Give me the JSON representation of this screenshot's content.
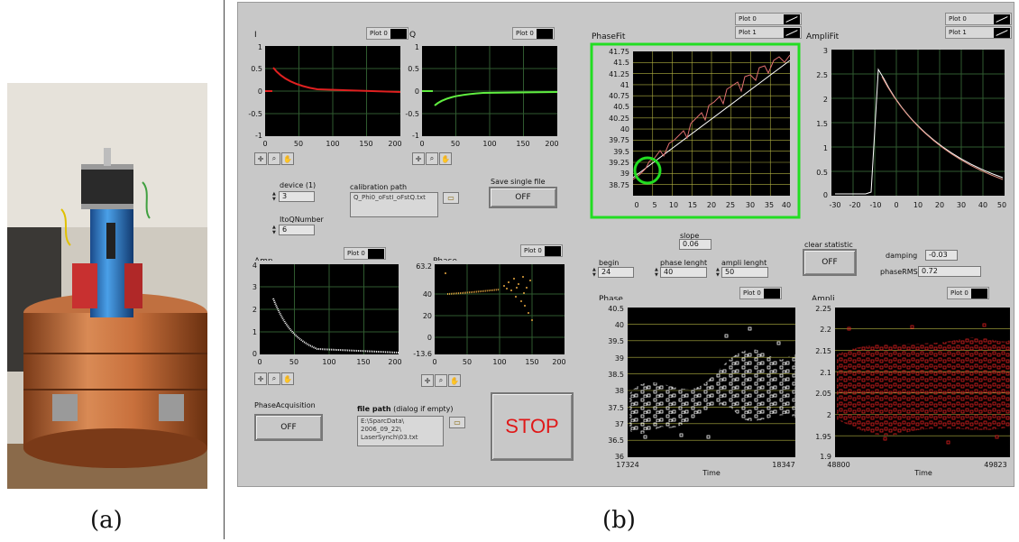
{
  "captions": {
    "a": "(a)",
    "b": "(b)"
  },
  "panel": {
    "plots": {
      "i": {
        "title": "I",
        "legend": "Plot 0",
        "y_ticks": [
          "1",
          "0.5",
          "0",
          "-0.5",
          "-1"
        ],
        "x_ticks": [
          "0",
          "50",
          "100",
          "150",
          "200"
        ]
      },
      "q": {
        "title": "Q",
        "legend": "Plot 0",
        "y_ticks": [
          "1",
          "0.5",
          "0",
          "-0.5",
          "-1"
        ],
        "x_ticks": [
          "0",
          "50",
          "100",
          "150",
          "200"
        ]
      },
      "phasefit": {
        "title": "PhaseFit",
        "legends": [
          "Plot 0",
          "Plot 1"
        ],
        "y_ticks": [
          "41.75",
          "41.5",
          "41.25",
          "41",
          "40.75",
          "40.5",
          "40.25",
          "40",
          "39.75",
          "39.5",
          "39.25",
          "39",
          "38.75"
        ],
        "x_ticks": [
          "0",
          "5",
          "10",
          "15",
          "20",
          "25",
          "30",
          "35",
          "40"
        ]
      },
      "amplifit": {
        "title": "AmpliFit",
        "legends": [
          "Plot 0",
          "Plot 1"
        ],
        "y_ticks": [
          "3",
          "2.5",
          "2",
          "1.5",
          "1",
          "0.5",
          "0"
        ],
        "x_ticks": [
          "-30",
          "-20",
          "-10",
          "0",
          "10",
          "20",
          "30",
          "40",
          "50"
        ]
      },
      "amp": {
        "title": "Amp",
        "legend": "Plot 0",
        "y_ticks": [
          "4",
          "3",
          "2",
          "1",
          "0"
        ],
        "x_ticks": [
          "0",
          "50",
          "100",
          "150",
          "200"
        ]
      },
      "phase_small": {
        "title": "Phase",
        "legend": "Plot 0",
        "y_ticks": [
          "63.2",
          "40",
          "20",
          "0",
          "-13.6"
        ],
        "x_ticks": [
          "0",
          "50",
          "100",
          "150",
          "200"
        ]
      },
      "phase_big": {
        "title": "Phase",
        "legend": "Plot 0",
        "y_ticks": [
          "40.5",
          "40",
          "39.5",
          "39",
          "38.5",
          "38",
          "37.5",
          "37",
          "36.5",
          "36"
        ],
        "x_ticks": [
          "17324",
          "18347"
        ],
        "xlabel": "Time"
      },
      "ampli_big": {
        "title": "Ampli",
        "legend": "Plot 0",
        "y_ticks": [
          "2.25",
          "2.2",
          "2.15",
          "2.1",
          "2.05",
          "2",
          "1.95",
          "1.9"
        ],
        "x_ticks": [
          "48800",
          "49823"
        ],
        "xlabel": "Time"
      }
    },
    "controls": {
      "device_label": "device (1)",
      "device_value": "3",
      "itqnumber_label": "ItoQNumber",
      "itqnumber_value": "6",
      "calibration_label": "calibration path",
      "calibration_value": "Q_Phi0_oFstI_oFstQ.txt",
      "save_label": "Save single file",
      "save_button": "OFF",
      "slope_label": "slope",
      "slope_value": "0.06",
      "begin_label": "begin",
      "begin_value": "24",
      "phase_length_label": "phase lenght",
      "phase_length_value": "40",
      "ampli_length_label": "ampli lenght",
      "ampli_length_value": "50",
      "clear_label": "clear statistic",
      "clear_button": "OFF",
      "damping_label": "damping",
      "damping_value": "-0.03",
      "phaserms_label": "phaseRMS",
      "phaserms_value": "0.72",
      "phaseacq_label": "PhaseAcquisition",
      "phaseacq_button": "OFF",
      "filepath_label": "file path",
      "filepath_hint": "(dialog if empty)",
      "filepath_value_1": "E:\\SparcData\\",
      "filepath_value_2": "2006_09_22\\",
      "filepath_value_3": "LaserSynch\\03.txt",
      "stop_button": "STOP"
    },
    "colors": {
      "plot_bg": "#000000",
      "grid": "#2f5a2f",
      "grid_alt": "#b0b040",
      "red": "#e02020",
      "green": "#60ee40",
      "orange": "#e8a840",
      "highlight": "#22dd22"
    }
  }
}
